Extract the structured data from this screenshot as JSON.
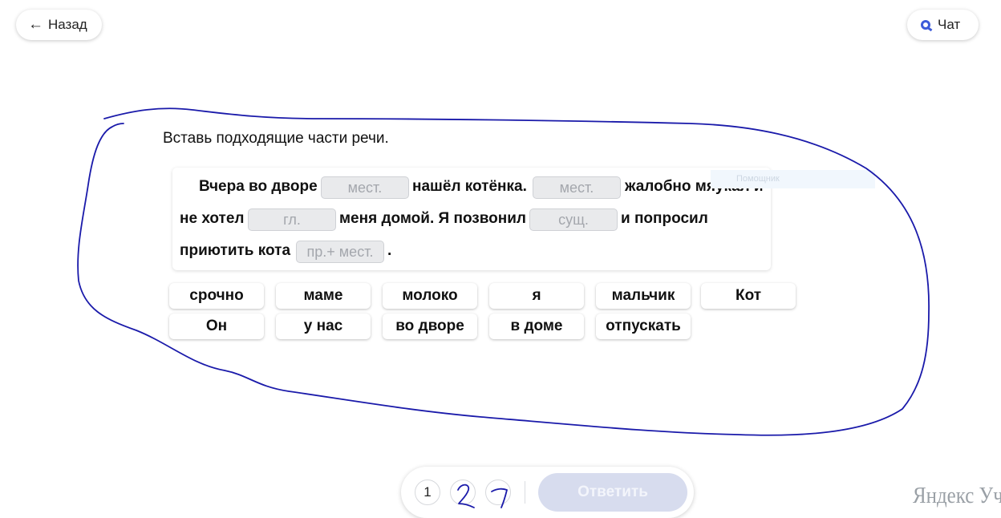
{
  "header": {
    "back_label": "Назад",
    "chat_label": "Чат"
  },
  "task": {
    "instruction": "Вставь подходящие части речи.",
    "line1": {
      "t1": "Вчера во дворе",
      "slot1": "мест.",
      "t2": "нашёл котёнка.",
      "slot2": "мест.",
      "t3": "жалобно мяукал и"
    },
    "line2": {
      "t1": "не хотел",
      "slot1": "гл.",
      "t2": "меня домой. Я позвонил",
      "slot2": "сущ.",
      "t3": "и попросил"
    },
    "line3": {
      "t1": "приютить кота",
      "slot1": "пр.+ мест.",
      "t2": "."
    },
    "ghost_hint": "Помощник"
  },
  "word_bank": [
    "срочно",
    "маме",
    "молоко",
    "я",
    "мальчик",
    "Кот",
    "Он",
    "у нас",
    "во дворе",
    "в доме",
    "отпускать"
  ],
  "pager": {
    "pages": [
      "1",
      "2",
      "3"
    ],
    "submit_label": "Ответить"
  },
  "watermark": "Яндекс Уче",
  "colors": {
    "ink": "#1a1aaa",
    "accent": "#3d5bd9",
    "submit_disabled": "#d7dcee",
    "slot_bg": "#e9eaec"
  }
}
